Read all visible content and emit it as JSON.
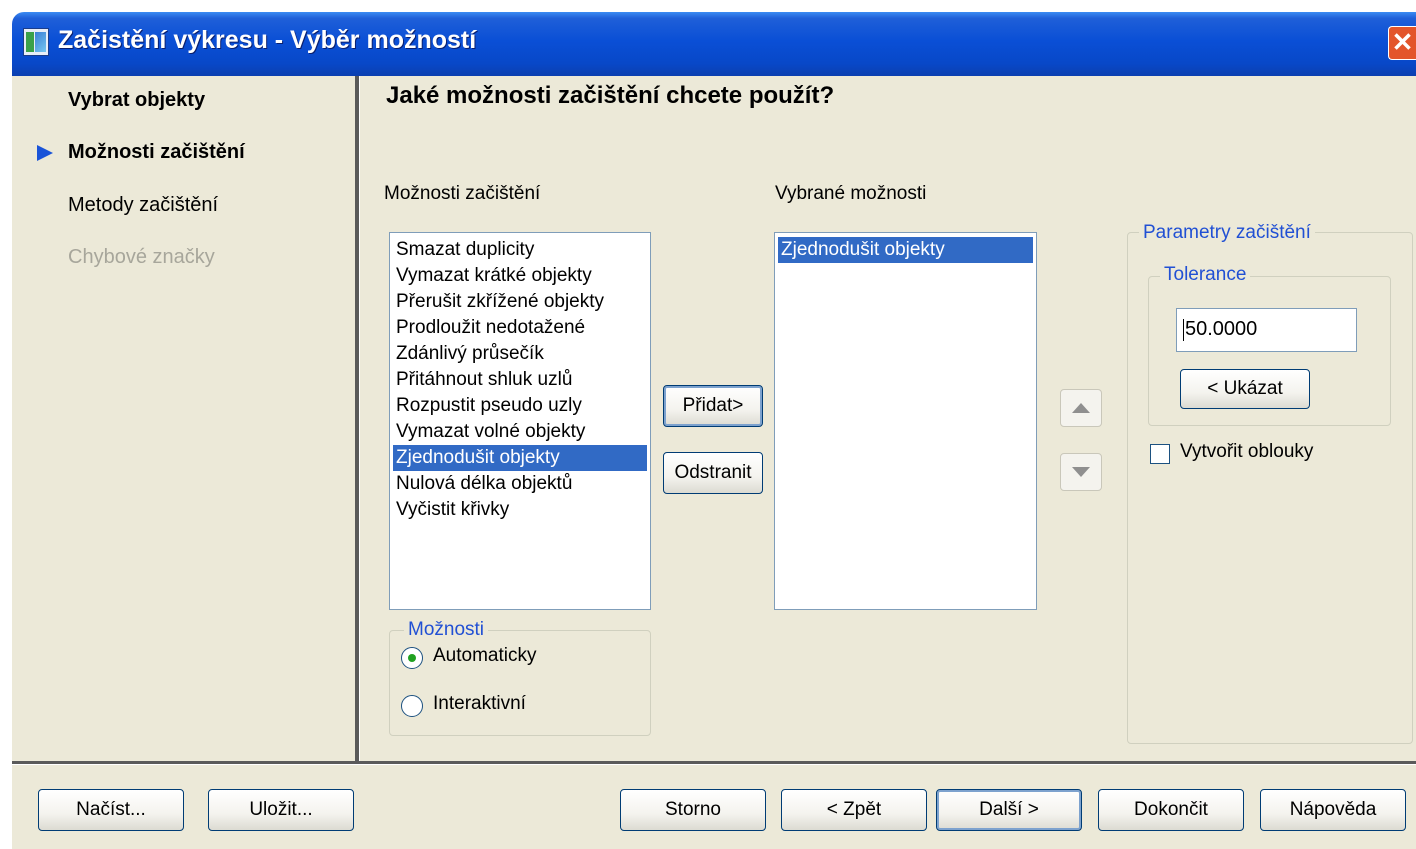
{
  "window": {
    "title": "Začistění výkresu - Výběr možností",
    "close_symbol": "✕"
  },
  "steps": [
    {
      "label": "Vybrat objekty",
      "state": "done"
    },
    {
      "label": "Možnosti začištění",
      "state": "current"
    },
    {
      "label": "Metody začištění",
      "state": "pending"
    },
    {
      "label": "Chybové značky",
      "state": "disabled"
    }
  ],
  "main": {
    "heading": "Jaké možnosti začištění chcete použít?",
    "available_label": "Možnosti začištění",
    "selected_label": "Vybrané možnosti",
    "available_options": [
      "Smazat duplicity",
      "Vymazat krátké objekty",
      "Přerušit zkřížené objekty",
      "Prodloužit nedotažené",
      "Zdánlivý průsečík",
      "Přitáhnout shluk uzlů",
      "Rozpustit pseudo uzly",
      "Vymazat volné objekty",
      "Zjednodušit objekty",
      "Nulová délka objektů",
      "Vyčistit křivky"
    ],
    "available_selected_index": 8,
    "selected_options": [
      "Zjednodušit objekty"
    ],
    "selected_selected_index": 0,
    "add_button": "Přidat>",
    "remove_button": "Odstranit",
    "move_up_icon": "arrow-up-icon",
    "move_down_icon": "arrow-down-icon"
  },
  "mode_group": {
    "legend": "Možnosti",
    "options": [
      "Automaticky",
      "Interaktivní"
    ],
    "selected": "Automaticky"
  },
  "params_group": {
    "legend": "Parametry začištění",
    "tolerance_legend": "Tolerance",
    "tolerance_value": "50.0000",
    "show_button": "< Ukázat",
    "create_arcs_label": "Vytvořit oblouky",
    "create_arcs_checked": false
  },
  "footer": {
    "load": "Načíst...",
    "save": "Uložit...",
    "cancel": "Storno",
    "back": "< Zpět",
    "next": "Další >",
    "finish": "Dokončit",
    "help": "Nápověda"
  },
  "colors": {
    "title_bar": "#0a4fd6",
    "selection": "#316ac5",
    "dialog_bg": "#ece9d8",
    "group_legend": "#2150d4",
    "disabled_text": "#a7a69b"
  }
}
